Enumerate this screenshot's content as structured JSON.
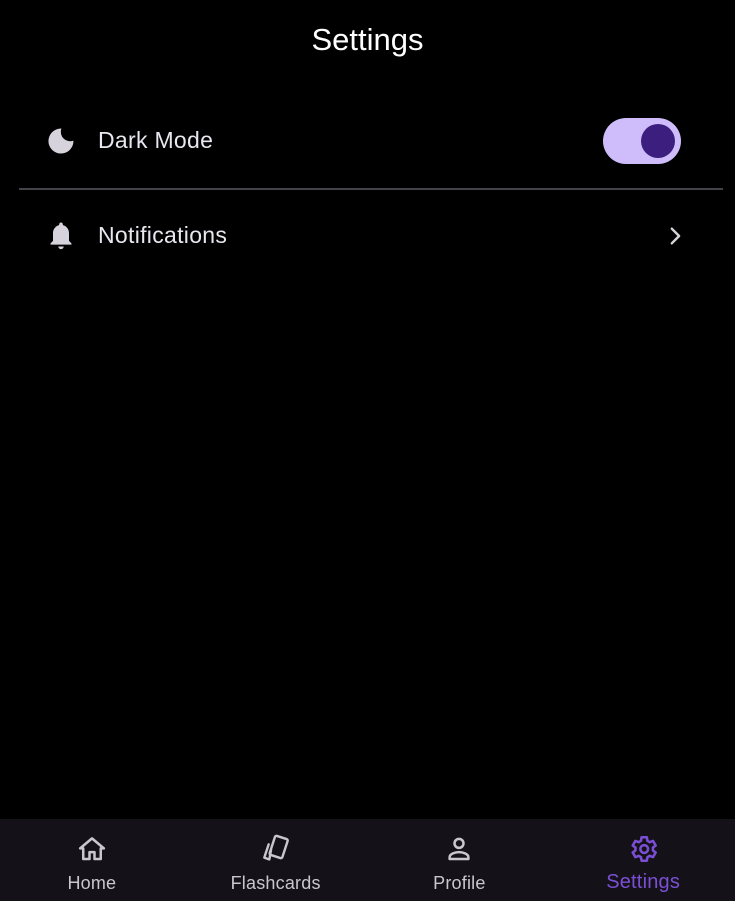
{
  "header": {
    "title": "Settings"
  },
  "settings": {
    "items": [
      {
        "label": "Dark Mode",
        "icon": "moon-icon",
        "control": "toggle",
        "toggle_on": true
      },
      {
        "label": "Notifications",
        "icon": "bell-icon",
        "control": "chevron-right-icon"
      }
    ]
  },
  "bottom_nav": {
    "items": [
      {
        "label": "Home",
        "icon": "home-icon",
        "active": false
      },
      {
        "label": "Flashcards",
        "icon": "cards-icon",
        "active": false
      },
      {
        "label": "Profile",
        "icon": "person-icon",
        "active": false
      },
      {
        "label": "Settings",
        "icon": "gear-icon",
        "active": true
      }
    ]
  },
  "colors": {
    "background": "#000000",
    "nav_background": "#141218",
    "accent": "#7b4ed6",
    "toggle_track": "#cfbdfb",
    "toggle_thumb": "#3b1e7d",
    "text_primary": "#e8e6ee",
    "divider": "#45434a"
  }
}
